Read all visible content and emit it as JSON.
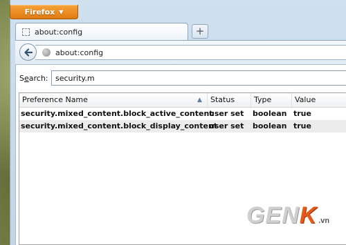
{
  "browser": {
    "menu_button_label": "Firefox",
    "menu_button_chevron": "▼",
    "new_tab_label": "+"
  },
  "tab": {
    "title": "about:config",
    "icon": "blank-page-icon"
  },
  "navigation": {
    "back_icon": "back-arrow-icon",
    "site_icon": "globe-icon",
    "url": "about:config"
  },
  "search": {
    "label_prefix": "S",
    "label_accesskey": "e",
    "label_suffix": "arch:",
    "value": "security.m"
  },
  "table": {
    "columns": {
      "name": "Preference Name",
      "status": "Status",
      "type": "Type",
      "value": "Value"
    },
    "sort_icon": "sort-ascending-icon",
    "rows": [
      {
        "name": "security.mixed_content.block_active_content",
        "status": "user set",
        "type": "boolean",
        "value": "true"
      },
      {
        "name": "security.mixed_content.block_display_content",
        "status": "user set",
        "type": "boolean",
        "value": "true"
      }
    ]
  },
  "watermark": {
    "brand_main": "GEN",
    "brand_k": "K",
    "brand_suffix": ".vn"
  },
  "colors": {
    "firefox_button": "#e8861f",
    "frame": "#c8dbec",
    "watermark_accent": "#e45a1a"
  }
}
